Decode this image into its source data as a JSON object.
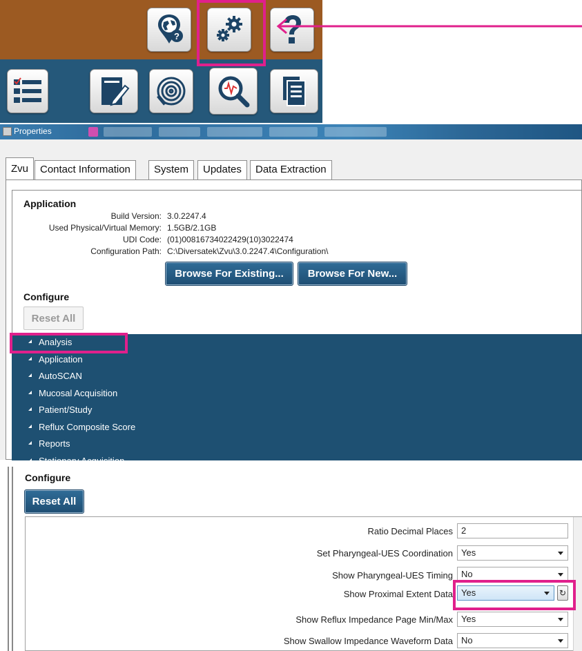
{
  "colors": {
    "toolbar_brown": "#9c5a22",
    "toolbar_blue": "#25587a",
    "highlight": "#e0208c",
    "tree_navy": "#1e5072",
    "button_navy": "#25587a"
  },
  "toolbar": {
    "top_icons": [
      "globe-help-icon",
      "gears-settings-icon",
      "question-mark-icon"
    ],
    "bottom_icons": [
      "checklist-icon",
      "notepad-edit-icon",
      "fingerprint-icon",
      "magnify-analysis-icon",
      "document-stack-icon"
    ]
  },
  "properties": {
    "title": "Properties",
    "tabs": [
      "Zvu",
      "Contact Information",
      "System",
      "Updates",
      "Data Extraction"
    ],
    "active_tab": "Zvu",
    "application": {
      "heading": "Application",
      "fields": [
        {
          "label": "Build Version:",
          "value": "3.0.2247.4"
        },
        {
          "label": "Used Physical/Virtual Memory:",
          "value": "1.5GB/2.1GB"
        },
        {
          "label": "UDI Code:",
          "value": "(01)00816734022429(10)3022474"
        },
        {
          "label": "Configuration Path:",
          "value": "C:\\Diversatek\\Zvu\\3.0.2247.4\\Configuration\\"
        }
      ],
      "browse_existing_label": "Browse For Existing...",
      "browse_new_label": "Browse For New..."
    },
    "configure": {
      "heading": "Configure",
      "reset_all_label": "Reset All",
      "tree_items": [
        "Analysis",
        "Application",
        "AutoSCAN",
        "Mucosal Acquisition",
        "Patient/Study",
        "Reflux Composite Score",
        "Reports",
        "Stationary Acquisition"
      ]
    }
  },
  "configure_detail": {
    "heading": "Configure",
    "reset_all_label": "Reset All",
    "rows": [
      {
        "label": "Ratio Decimal Places",
        "value": "2",
        "kind": "text"
      },
      {
        "label": "Set Pharyngeal-UES Coordination",
        "value": "Yes",
        "kind": "dropdown"
      },
      {
        "label": "Show Pharyngeal-UES Timing",
        "value": "No",
        "kind": "dropdown"
      },
      {
        "label": "Show Proximal Extent Data",
        "value": "Yes",
        "kind": "dropdown"
      },
      {
        "label": "Show Reflux Impedance Page Min/Max",
        "value": "Yes",
        "kind": "dropdown"
      },
      {
        "label": "Show Swallow Impedance Waveform Data",
        "value": "No",
        "kind": "dropdown"
      }
    ],
    "reset_icon": "refresh-icon"
  }
}
